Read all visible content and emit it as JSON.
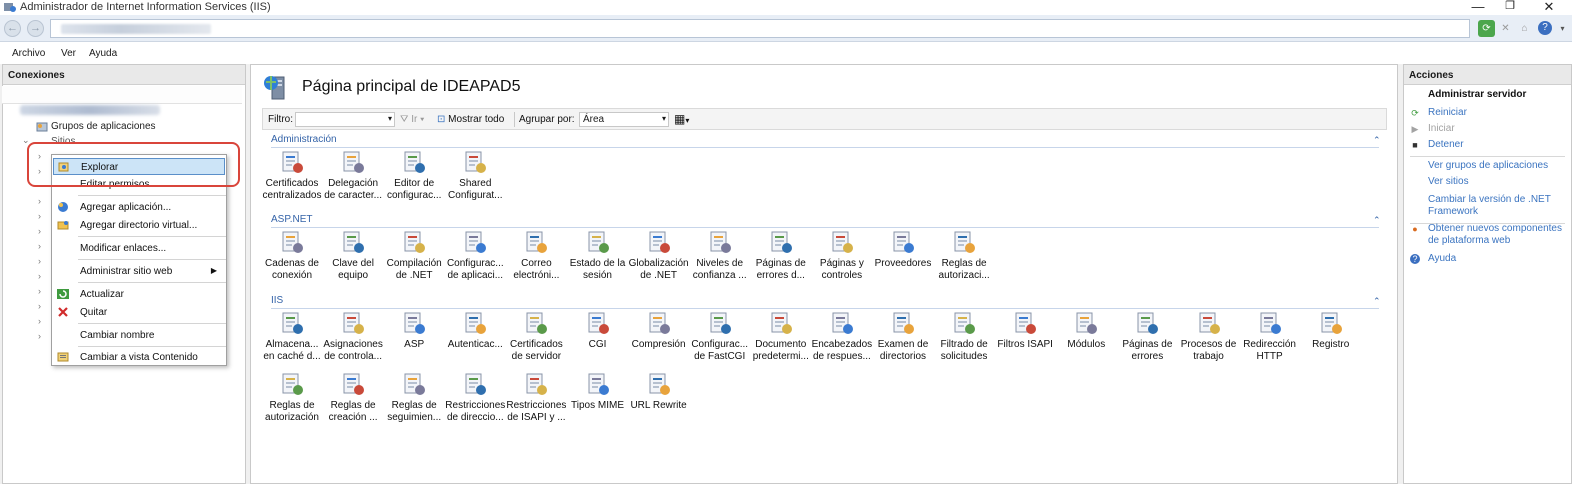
{
  "window": {
    "title": "Administrador de Internet Information Services (IIS)",
    "controls": [
      "—",
      "❐",
      "✕"
    ]
  },
  "menu": [
    "Archivo",
    "Ver",
    "Ayuda"
  ],
  "connections": {
    "header": "Conexiones",
    "tree": [
      {
        "label": "Grupos de aplicaciones"
      },
      {
        "label": "Sitios"
      }
    ]
  },
  "context_menu": {
    "items": [
      {
        "label": "Explorar",
        "icon": "explore-icon",
        "selected": true
      },
      {
        "label": "Editar permisos...",
        "icon": ""
      },
      {
        "label": "Agregar aplicación...",
        "icon": "add-application-icon"
      },
      {
        "label": "Agregar directorio virtual...",
        "icon": "add-virtual-directory-icon"
      },
      {
        "label": "Modificar enlaces...",
        "icon": ""
      },
      {
        "label": "Administrar sitio web",
        "icon": "",
        "submenu": true
      },
      {
        "label": "Actualizar",
        "icon": "refresh-icon"
      },
      {
        "label": "Quitar",
        "icon": "remove-icon"
      },
      {
        "label": "Cambiar nombre",
        "icon": ""
      },
      {
        "label": "Cambiar a vista Contenido",
        "icon": "content-view-icon"
      }
    ]
  },
  "main": {
    "title": "Página principal de IDEAPAD5",
    "filter": {
      "label": "Filtro:",
      "go_label": "Ir",
      "show_all": "Mostrar todo",
      "group_by_label": "Agrupar por:",
      "group_by_value": "Área"
    },
    "sections": [
      {
        "name": "Administración",
        "features": [
          {
            "line1": "Certificados",
            "line2": "centralizados",
            "icon": "certificates-icon"
          },
          {
            "line1": "Delegación",
            "line2": "de caracter...",
            "icon": "delegation-icon"
          },
          {
            "line1": "Editor de",
            "line2": "configurac...",
            "icon": "config-editor-icon"
          },
          {
            "line1": "Shared",
            "line2": "Configurat...",
            "icon": "shared-config-icon"
          }
        ]
      },
      {
        "name": "ASP.NET",
        "features": [
          {
            "line1": "Cadenas de",
            "line2": "conexión",
            "icon": "connection-strings-icon"
          },
          {
            "line1": "Clave del",
            "line2": "equipo",
            "icon": "machine-key-icon"
          },
          {
            "line1": "Compilación",
            "line2": "de .NET",
            "icon": "net-compilation-icon"
          },
          {
            "line1": "Configurac...",
            "line2": "de aplicaci...",
            "icon": "app-settings-icon"
          },
          {
            "line1": "Correo",
            "line2": "electróni...",
            "icon": "smtp-email-icon"
          },
          {
            "line1": "Estado de la",
            "line2": "sesión",
            "icon": "session-state-icon"
          },
          {
            "line1": "Globalización",
            "line2": "de .NET",
            "icon": "globalization-icon"
          },
          {
            "line1": "Niveles de",
            "line2": "confianza ...",
            "icon": "trust-levels-icon"
          },
          {
            "line1": "Páginas de",
            "line2": "errores d...",
            "icon": "net-error-pages-icon"
          },
          {
            "line1": "Páginas y",
            "line2": "controles",
            "icon": "pages-controls-icon"
          },
          {
            "line1": "Proveedores",
            "line2": "",
            "icon": "providers-icon"
          },
          {
            "line1": "Reglas de",
            "line2": "autorizaci...",
            "icon": "net-authorization-icon"
          }
        ]
      },
      {
        "name": "IIS",
        "features": [
          {
            "line1": "Almacena...",
            "line2": "en caché d...",
            "icon": "output-caching-icon"
          },
          {
            "line1": "Asignaciones",
            "line2": "de controla...",
            "icon": "handler-mappings-icon"
          },
          {
            "line1": "ASP",
            "line2": "",
            "icon": "asp-icon"
          },
          {
            "line1": "Autenticac...",
            "line2": "",
            "icon": "authentication-icon"
          },
          {
            "line1": "Certificados",
            "line2": "de servidor",
            "icon": "server-certificates-icon"
          },
          {
            "line1": "CGI",
            "line2": "",
            "icon": "cgi-icon"
          },
          {
            "line1": "Compresión",
            "line2": "",
            "icon": "compression-icon"
          },
          {
            "line1": "Configurac...",
            "line2": "de FastCGI",
            "icon": "fastcgi-icon"
          },
          {
            "line1": "Documento",
            "line2": "predetermi...",
            "icon": "default-document-icon"
          },
          {
            "line1": "Encabezados",
            "line2": "de respues...",
            "icon": "response-headers-icon"
          },
          {
            "line1": "Examen de",
            "line2": "directorios",
            "icon": "directory-browsing-icon"
          },
          {
            "line1": "Filtrado de",
            "line2": "solicitudes",
            "icon": "request-filtering-icon"
          },
          {
            "line1": "Filtros ISAPI",
            "line2": "",
            "icon": "isapi-filters-icon"
          },
          {
            "line1": "Módulos",
            "line2": "",
            "icon": "modules-icon"
          },
          {
            "line1": "Páginas de",
            "line2": "errores",
            "icon": "error-pages-icon"
          },
          {
            "line1": "Procesos de",
            "line2": "trabajo",
            "icon": "worker-processes-icon"
          },
          {
            "line1": "Redirección",
            "line2": "HTTP",
            "icon": "http-redirect-icon"
          },
          {
            "line1": "Registro",
            "line2": "",
            "icon": "logging-icon"
          },
          {
            "line1": "Reglas de",
            "line2": "autorización",
            "icon": "authorization-rules-icon"
          },
          {
            "line1": "Reglas de",
            "line2": "creación ...",
            "icon": "failed-request-rules-icon"
          },
          {
            "line1": "Reglas de",
            "line2": "seguimien...",
            "icon": "tracing-rules-icon"
          },
          {
            "line1": "Restricciones",
            "line2": "de direccio...",
            "icon": "ip-restrictions-icon"
          },
          {
            "line1": "Restricciones",
            "line2": "de ISAPI y ...",
            "icon": "isapi-cgi-restrictions-icon"
          },
          {
            "line1": "Tipos MIME",
            "line2": "",
            "icon": "mime-types-icon"
          },
          {
            "line1": "URL Rewrite",
            "line2": "",
            "icon": "url-rewrite-icon"
          }
        ]
      }
    ]
  },
  "actions": {
    "header": "Acciones",
    "group_title": "Administrar servidor",
    "items": [
      {
        "label": "Reiniciar",
        "enabled": true,
        "icon": "restart-icon"
      },
      {
        "label": "Iniciar",
        "enabled": false,
        "icon": "start-icon"
      },
      {
        "label": "Detener",
        "enabled": true,
        "icon": "stop-icon"
      },
      {
        "label": "Ver grupos de aplicaciones",
        "enabled": true,
        "icon": ""
      },
      {
        "label": "Ver sitios",
        "enabled": true,
        "icon": ""
      },
      {
        "label": "Cambiar la versión de .NET Framework",
        "enabled": true,
        "icon": ""
      },
      {
        "label": "Obtener nuevos componentes de plataforma web",
        "enabled": true,
        "icon": "web-platform-icon"
      },
      {
        "label": "Ayuda",
        "enabled": true,
        "icon": "help-icon"
      }
    ]
  },
  "colors": {
    "link": "#3b74c0",
    "section_header": "#3463a8",
    "highlight": "#d9453b",
    "selection": "#cce4f7"
  }
}
